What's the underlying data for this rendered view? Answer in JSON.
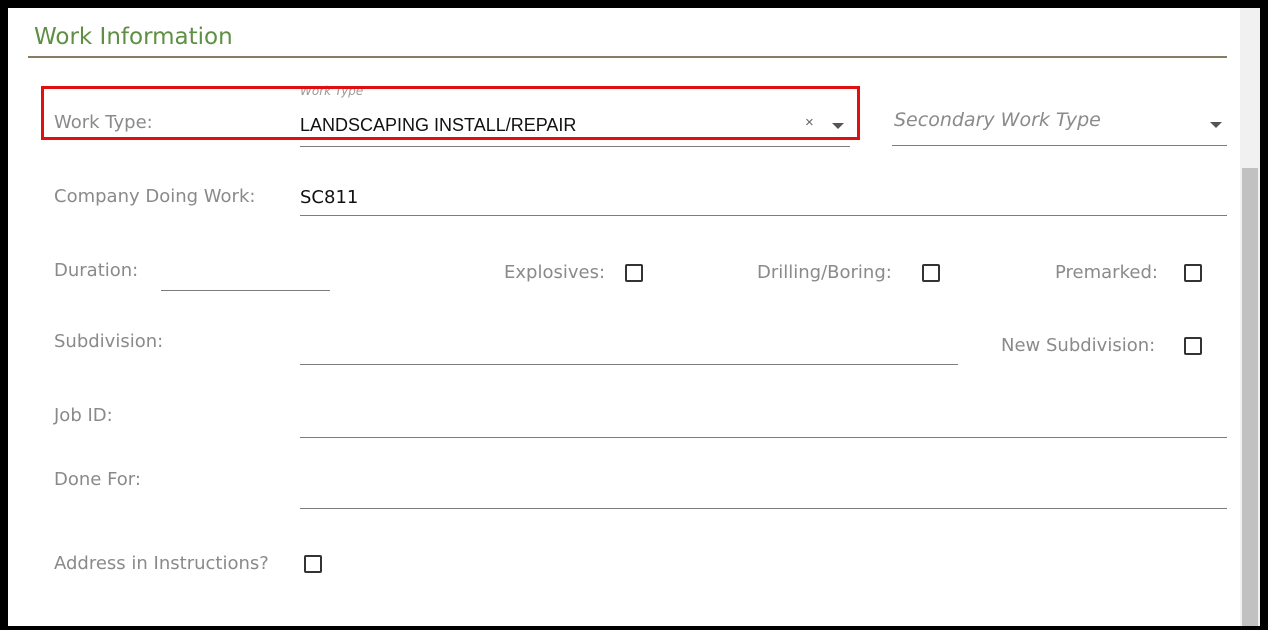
{
  "section": {
    "title": "Work Information"
  },
  "work_type": {
    "label": "Work Type:",
    "float_label": "Work Type",
    "value": "LANDSCAPING INSTALL/REPAIR",
    "clear_symbol": "×",
    "icons": [
      "close-icon",
      "caret-down-icon"
    ]
  },
  "secondary_work_type": {
    "placeholder": "Secondary Work Type"
  },
  "company": {
    "label": "Company Doing Work:",
    "value": "SC811"
  },
  "duration": {
    "label": "Duration:",
    "value": ""
  },
  "explosives": {
    "label": "Explosives:",
    "checked": false
  },
  "drilling": {
    "label": "Drilling/Boring:",
    "checked": false
  },
  "premarked": {
    "label": "Premarked:",
    "checked": false
  },
  "subdivision": {
    "label": "Subdivision:",
    "value": ""
  },
  "new_subdivision": {
    "label": "New Subdivision:",
    "checked": false
  },
  "job_id": {
    "label": "Job ID:",
    "value": ""
  },
  "done_for": {
    "label": "Done For:",
    "value": ""
  },
  "address_in_instructions": {
    "label": "Address in Instructions?",
    "checked": false
  },
  "colors": {
    "title": "#5e8f43",
    "highlight": "#e01010",
    "rule": "#8a7a64"
  }
}
